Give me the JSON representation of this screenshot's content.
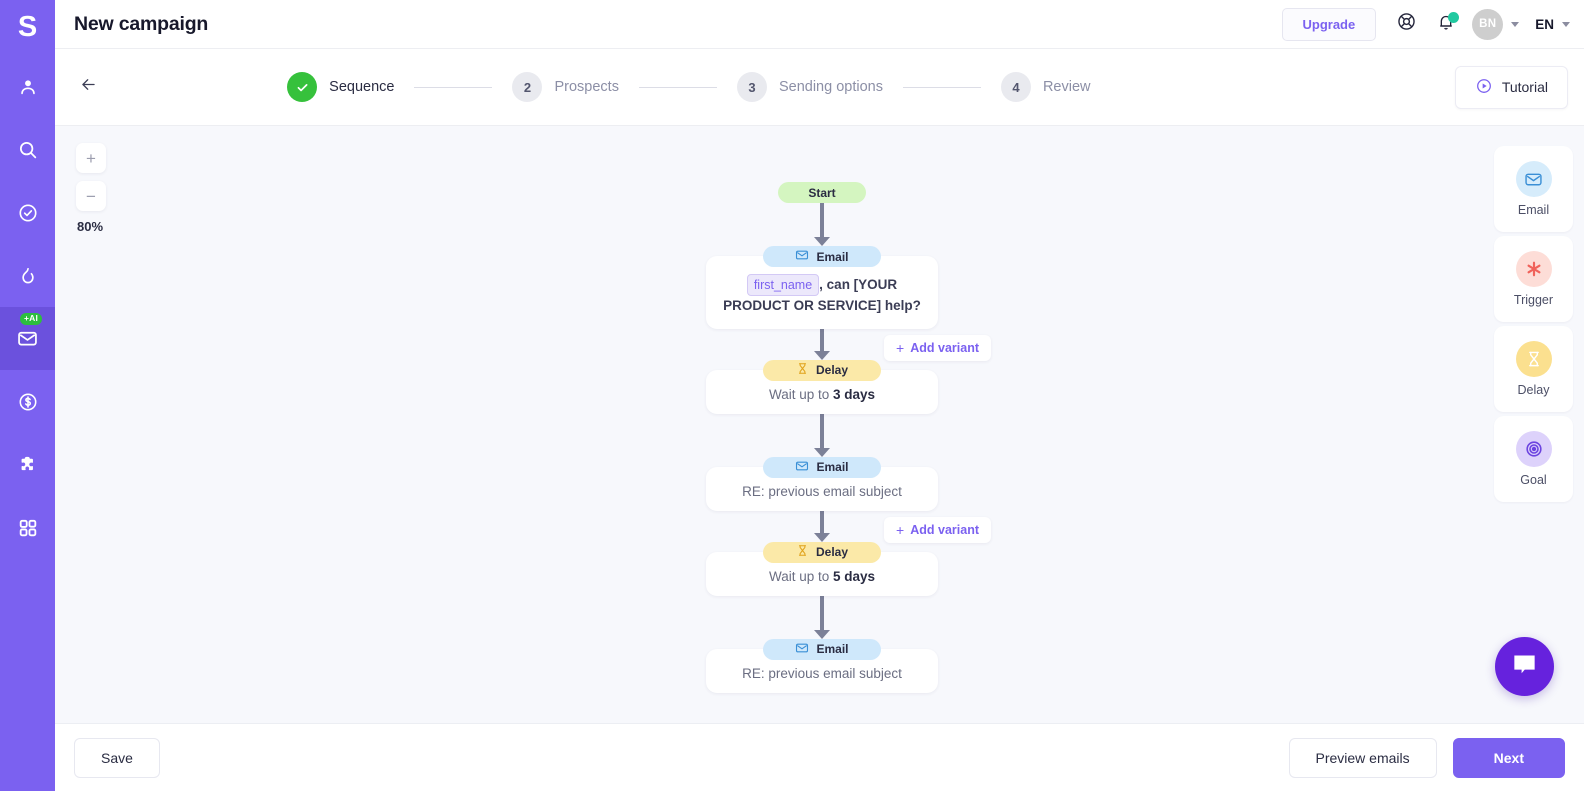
{
  "theme": {
    "brand": "#7b61f0",
    "sidebar_bg": "#7b61f0",
    "canvas_bg": "#f7f8fc",
    "success_green": "#36c13c",
    "chat_purple": "#6622dd",
    "notif_green": "#21c9a0"
  },
  "sidebar": {
    "logo": "S",
    "items": [
      {
        "icon": "person-icon",
        "name": "sidebar-item-person",
        "active": false,
        "badge": ""
      },
      {
        "icon": "search-icon",
        "name": "sidebar-item-search",
        "active": false,
        "badge": ""
      },
      {
        "icon": "check-circle-icon",
        "name": "sidebar-item-tasks",
        "active": false,
        "badge": ""
      },
      {
        "icon": "flame-icon",
        "name": "sidebar-item-hot",
        "active": false,
        "badge": ""
      },
      {
        "icon": "mail-icon",
        "name": "sidebar-item-campaigns",
        "active": true,
        "badge": "+AI"
      },
      {
        "icon": "dollar-circle-icon",
        "name": "sidebar-item-deals",
        "active": false,
        "badge": ""
      },
      {
        "icon": "puzzle-icon",
        "name": "sidebar-item-integrations",
        "active": false,
        "badge": ""
      },
      {
        "icon": "grid-icon",
        "name": "sidebar-item-apps",
        "active": false,
        "badge": ""
      }
    ]
  },
  "header": {
    "title": "New campaign",
    "upgrade_label": "Upgrade",
    "support_icon": "lifebuoy-icon",
    "bell_icon": "bell-icon",
    "avatar_initials": "BN",
    "language": "EN"
  },
  "stepper": {
    "back_icon": "arrow-left-icon",
    "steps": [
      {
        "number": "1",
        "label": "Sequence",
        "state": "done"
      },
      {
        "number": "2",
        "label": "Prospects",
        "state": "todo"
      },
      {
        "number": "3",
        "label": "Sending options",
        "state": "todo"
      },
      {
        "number": "4",
        "label": "Review",
        "state": "todo"
      }
    ],
    "tutorial_label": "Tutorial",
    "tutorial_icon": "play-circle-icon"
  },
  "canvas": {
    "zoom_in_label": "+",
    "zoom_out_label": "−",
    "zoom_level": "80%"
  },
  "flow": {
    "start_label": "Start",
    "nodes": [
      {
        "type": "email",
        "pill_label": "Email",
        "icon": "envelope-icon",
        "variable": "first_name",
        "subject_rest": ", can [YOUR PRODUCT OR SERVICE] help?",
        "add_variant_label": "Add variant"
      },
      {
        "type": "delay",
        "pill_label": "Delay",
        "icon": "hourglass-icon",
        "wait_prefix": "Wait up to",
        "wait_value": "3 days"
      },
      {
        "type": "email",
        "pill_label": "Email",
        "icon": "envelope-icon",
        "subject": "RE: previous email subject",
        "add_variant_label": "Add variant"
      },
      {
        "type": "delay",
        "pill_label": "Delay",
        "icon": "hourglass-icon",
        "wait_prefix": "Wait up to",
        "wait_value": "5 days"
      },
      {
        "type": "email",
        "pill_label": "Email",
        "icon": "envelope-icon",
        "subject": "RE: previous email subject"
      }
    ]
  },
  "palette": {
    "tiles": [
      {
        "label": "Email",
        "icon": "envelope-icon"
      },
      {
        "label": "Trigger",
        "icon": "asterisk-icon"
      },
      {
        "label": "Delay",
        "icon": "hourglass-icon"
      },
      {
        "label": "Goal",
        "icon": "target-icon"
      }
    ]
  },
  "chat": {
    "icon": "chat-bubble-icon"
  },
  "footer": {
    "save_label": "Save",
    "preview_label": "Preview emails",
    "next_label": "Next"
  }
}
